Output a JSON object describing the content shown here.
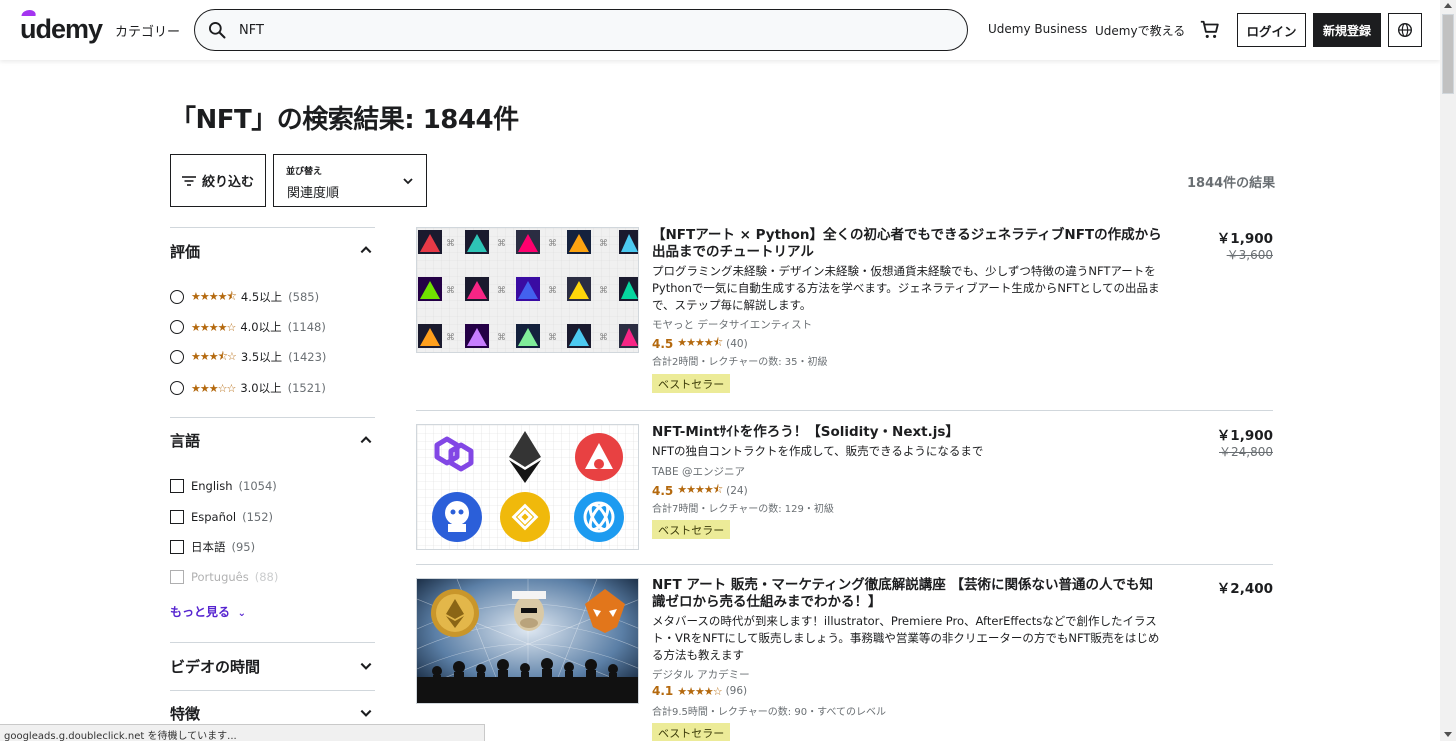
{
  "header": {
    "logo": "udemy",
    "categories_label": "カテゴリー",
    "search_value": "NFT",
    "business_link": "Udemy Business",
    "teach_link": "Udemyで教える",
    "login_label": "ログイン",
    "signup_label": "新規登録"
  },
  "page": {
    "title": "「NFT」の検索結果: 1844件",
    "filter_label": "絞り込む",
    "sort_label": "並び替え",
    "sort_value": "関連度順",
    "result_count": "1844件の結果"
  },
  "sidebar": {
    "rating": {
      "title": "評価",
      "options": [
        {
          "stars": "★★★★⯪",
          "label": "4.5以上",
          "count": "(585)"
        },
        {
          "stars": "★★★★☆",
          "label": "4.0以上",
          "count": "(1148)"
        },
        {
          "stars": "★★★⯪☆",
          "label": "3.5以上",
          "count": "(1423)"
        },
        {
          "stars": "★★★☆☆",
          "label": "3.0以上",
          "count": "(1521)"
        }
      ]
    },
    "language": {
      "title": "言語",
      "options": [
        {
          "label": "English",
          "count": "(1054)"
        },
        {
          "label": "Español",
          "count": "(152)"
        },
        {
          "label": "日本語",
          "count": "(95)"
        },
        {
          "label": "Português",
          "count": "(88)"
        }
      ],
      "more": "もっと見る"
    },
    "video_length": {
      "title": "ビデオの時間"
    },
    "features": {
      "title": "特徴"
    }
  },
  "courses": [
    {
      "title": "【NFTアート × Python】全くの初心者でもできるジェネラティブNFTの作成から出品までのチュートリアル",
      "description": "プログラミング未経験・デザイン未経験・仮想通貨未経験でも、少しずつ特徴の違うNFTアートをPythonで一気に自動生成する方法を学べます。ジェネラティブアート生成からNFTとしての出品まで、ステップ毎に解説します。",
      "instructor": "モヤっと データサイエンティスト",
      "rating": "4.5",
      "stars": "★★★★⯪",
      "reviews": "(40)",
      "meta": "合計2時間・レクチャーの数: 35・初級",
      "badge": "ベストセラー",
      "price": "￥1,900",
      "old_price": "￥3,600"
    },
    {
      "title": "NFT-Mintｻｲﾄを作ろう！【Solidity・Next.js】",
      "description": "NFTの独自コントラクトを作成して、販売できるようになるまで",
      "instructor": "TABE @エンジニア",
      "rating": "4.5",
      "stars": "★★★★⯪",
      "reviews": "(24)",
      "meta": "合計7時間・レクチャーの数: 129・初級",
      "badge": "ベストセラー",
      "price": "￥1,900",
      "old_price": "￥24,800"
    },
    {
      "title": "NFT アート 販売・マーケティング徹底解説講座 【芸術に関係ない普通の人でも知識ゼロから売る仕組みまでわかる！】",
      "description": "メタバースの時代が到来します！illustrator、Premiere Pro、AfterEffectsなどで創作したイラスト・VRをNFTにして販売しましょう。事務職や営業等の非クリエーターの方でもNFT販売をはじめる方法も教えます",
      "instructor": "デジタル アカデミー",
      "rating": "4.1",
      "stars": "★★★★☆",
      "reviews": "(96)",
      "meta": "合計9.5時間・レクチャーの数: 90・すべてのレベル",
      "badge": "ベストセラー",
      "price": "￥2,400"
    }
  ],
  "status_bar": "googleads.g.doubleclick.net を待機しています...",
  "colors": {
    "accent": "#a435f0",
    "star": "#b4690e",
    "link": "#5624d0",
    "badge_bg": "#eceb98"
  }
}
